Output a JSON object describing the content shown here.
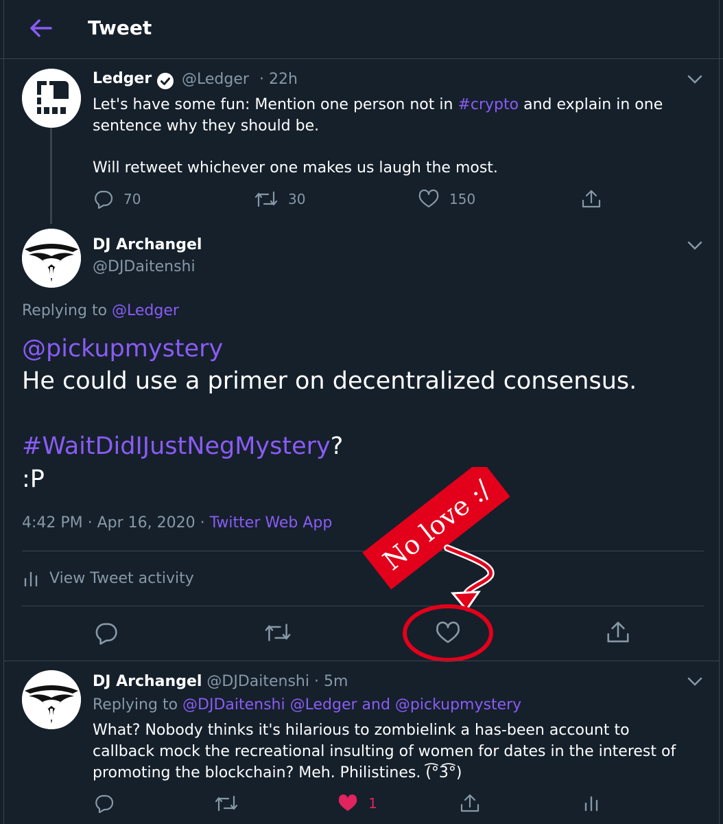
{
  "header": {
    "title": "Tweet"
  },
  "parent_tweet": {
    "name": "Ledger",
    "handle": "@Ledger",
    "time": "· 22h",
    "text_before": "Let's have some fun: Mention one person not in ",
    "hashtag": "#crypto",
    "text_after": " and explain in one",
    "line2": "sentence why they should be.",
    "line3": "Will retweet whichever one makes us laugh the most.",
    "replies": "70",
    "retweets": "30",
    "likes": "150"
  },
  "main_tweet": {
    "name": "DJ Archangel",
    "handle": "@DJDaitenshi",
    "replying_prefix": "Replying to ",
    "replying_to": "@Ledger",
    "mention": "@pickupmystery",
    "line1": "He could use a primer on decentralized consensus.",
    "hashtag": "#WaitDidIJustNegMystery",
    "hashtag_suffix": "?",
    "line3": ":P",
    "timestamp": "4:42 PM · Apr 16, 2020 · ",
    "source": "Twitter Web App",
    "activity_label": "View Tweet activity"
  },
  "annotation": {
    "text": "No love :/",
    "color": "#e3001b"
  },
  "reply_tweet": {
    "name": "DJ Archangel",
    "handle": "@DJDaitenshi",
    "time": "· 5m",
    "replying_prefix": "Replying to ",
    "replying_to": "@DJDaitenshi @Ledger and @pickupmystery",
    "line1": "What? Nobody thinks it's hilarious to zombielink a has-been account to",
    "line2": "callback mock the recreational insulting of women for dates in the interest of",
    "line3": "promoting the blockchain? Meh. Philistines. (͡°3͡°)",
    "likes": "1"
  },
  "colors": {
    "background": "#15202b",
    "accent": "#8a5cf5",
    "like": "#e0245e",
    "muted": "#8899a6",
    "border": "#38444d"
  }
}
